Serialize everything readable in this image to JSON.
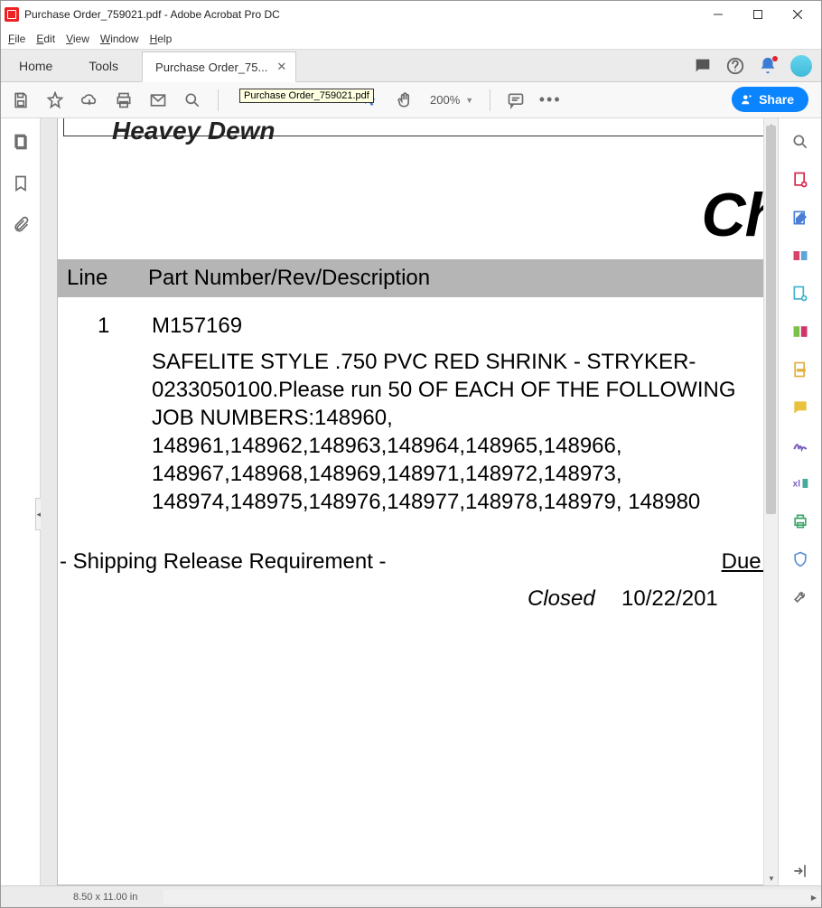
{
  "window": {
    "title": "Purchase Order_759021.pdf - Adobe Acrobat Pro DC"
  },
  "menu": {
    "file": "File",
    "edit": "Edit",
    "view": "View",
    "window": "Window",
    "help": "Help"
  },
  "tabs": {
    "home": "Home",
    "tools": "Tools",
    "doc_label": "Purchase Order_75..."
  },
  "tooltip": {
    "text": "Purchase Order_759021.pdf"
  },
  "toolbar": {
    "zoom": "200%",
    "share": "Share"
  },
  "document": {
    "heavy": "Heavey Dewn",
    "cha": "Cha",
    "headers": {
      "line": "Line",
      "part": "Part Number/Rev/Description"
    },
    "line_no": "1",
    "part_no": "M157169",
    "description": "SAFELITE STYLE .750 PVC RED SHRINK - STRYKER-0233050100.Please run  50 OF EACH OF THE FOLLOWING JOB NUMBERS:148960, 148961,148962,148963,148964,148965,148966, 148967,148968,148969,148971,148972,148973, 148974,148975,148976,148977,148978,148979, 148980",
    "ship_req": "- Shipping Release Requirement -",
    "due_date_label": "Due Da",
    "closed_label": "Closed",
    "closed_date": "10/22/201"
  },
  "status": {
    "page_size": "8.50 x 11.00 in"
  }
}
